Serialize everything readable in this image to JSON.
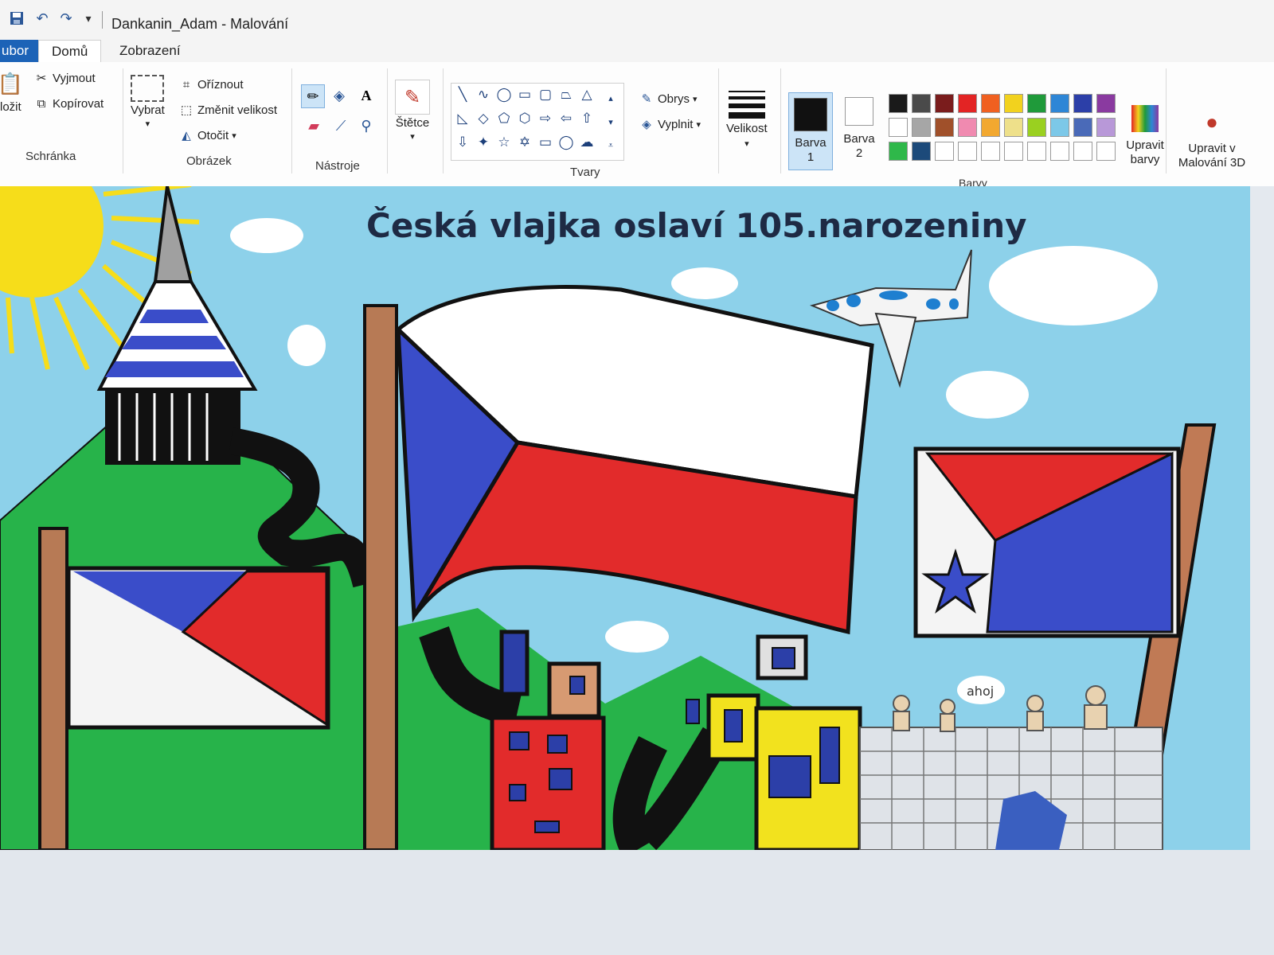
{
  "window": {
    "title": "Dankanin_Adam - Malování"
  },
  "quick_access": [
    "save-icon",
    "undo-icon",
    "redo-icon",
    "customize-icon"
  ],
  "tabs": {
    "file": "ubor",
    "home": "Domů",
    "view": "Zobrazení"
  },
  "clipboard": {
    "paste": "ložit",
    "cut": "Vyjmout",
    "copy": "Kopírovat",
    "label": "Schránka"
  },
  "image": {
    "select": "Vybrat",
    "crop": "Oříznout",
    "resize": "Změnit velikost",
    "rotate": "Otočit",
    "label": "Obrázek"
  },
  "tools": {
    "label": "Nástroje",
    "icons": [
      "pencil-icon",
      "fill-icon",
      "text-icon",
      "eraser-icon",
      "color-picker-icon",
      "magnifier-icon"
    ]
  },
  "brushes": {
    "label": "Štětce"
  },
  "shapes": {
    "label": "Tvary",
    "outline": "Obrys",
    "fill": "Vyplnit"
  },
  "size": {
    "label": "Velikost"
  },
  "colors": {
    "label": "Barvy",
    "color1_a": "Barva",
    "color1_b": "1",
    "color2_a": "Barva",
    "color2_b": "2",
    "edit_a": "Upravit",
    "edit_b": "barvy",
    "paint3d_a": "Upravit v",
    "paint3d_b": "Malování 3D",
    "palette_row1": [
      "#1a1a1a",
      "#4a4a4a",
      "#7a1c1c",
      "#e32424",
      "#f06020",
      "#f2d21e",
      "#1f9a3a",
      "#2e86d6",
      "#2c3fa8",
      "#8a3aa0"
    ],
    "palette_row2": [
      "#ffffff",
      "#a6a6a6",
      "#a0502a",
      "#f08ab0",
      "#f2a830",
      "#eee08a",
      "#9ad020",
      "#7cc8e8",
      "#4a6ab8",
      "#b898d8"
    ],
    "palette_row3": [
      "#2fb84a",
      "#1c4a7a",
      "#ffffff",
      "#ffffff",
      "#ffffff",
      "#ffffff",
      "#ffffff",
      "#ffffff",
      "#ffffff",
      "#ffffff"
    ]
  },
  "drawing": {
    "headline": "Česká vlajka oslaví 105.narozeniny",
    "speech": "ahoj"
  }
}
